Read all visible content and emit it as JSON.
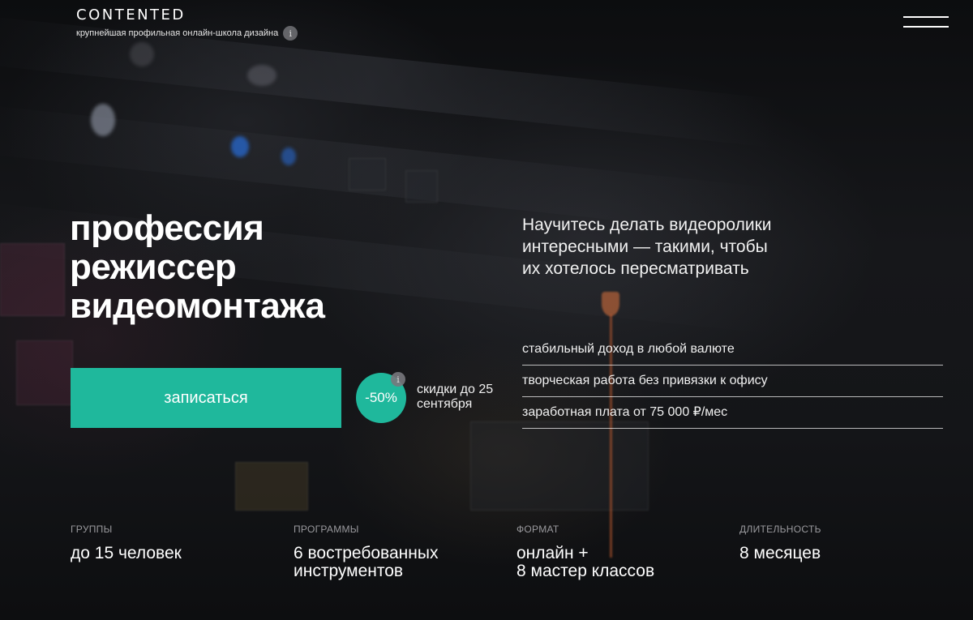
{
  "header": {
    "logo": "CONTENTED",
    "tagline": "крупнейшая профильная онлайн-школа дизайна",
    "info_icon": "i"
  },
  "hero": {
    "title_lines": [
      "профессия",
      "режиссер",
      "видеомонтажа"
    ],
    "subtitle_lines": [
      "Научитесь делать видеоролики",
      "интересными — такими, чтобы",
      "их хотелось пересматривать"
    ]
  },
  "benefits": [
    "стабильный доход в любой валюте",
    "творческая работа без привязки к офису",
    "заработная плата от 75 000 ₽/мес"
  ],
  "cta": {
    "button_label": "записаться",
    "discount": "-50%",
    "discount_info_icon": "i",
    "discount_text_lines": [
      "скидки до 25",
      "сентября"
    ]
  },
  "stats": [
    {
      "label": "ГРУППЫ",
      "value_lines": [
        "до 15 человек"
      ]
    },
    {
      "label": "ПРОГРАММЫ",
      "value_lines": [
        "6 востребованных",
        "инструментов"
      ]
    },
    {
      "label": "ФОРМАТ",
      "value_lines": [
        "онлайн +",
        "8 мастер классов"
      ]
    },
    {
      "label": "ДЛИТЕЛЬНОСТЬ",
      "value_lines": [
        "8 месяцев"
      ]
    }
  ],
  "colors": {
    "accent": "#1fb89c",
    "background": "#0f1012",
    "text": "#ffffff",
    "muted": "#9a9a9e"
  },
  "icons": {
    "menu": "hamburger-icon",
    "info": "info-icon"
  }
}
